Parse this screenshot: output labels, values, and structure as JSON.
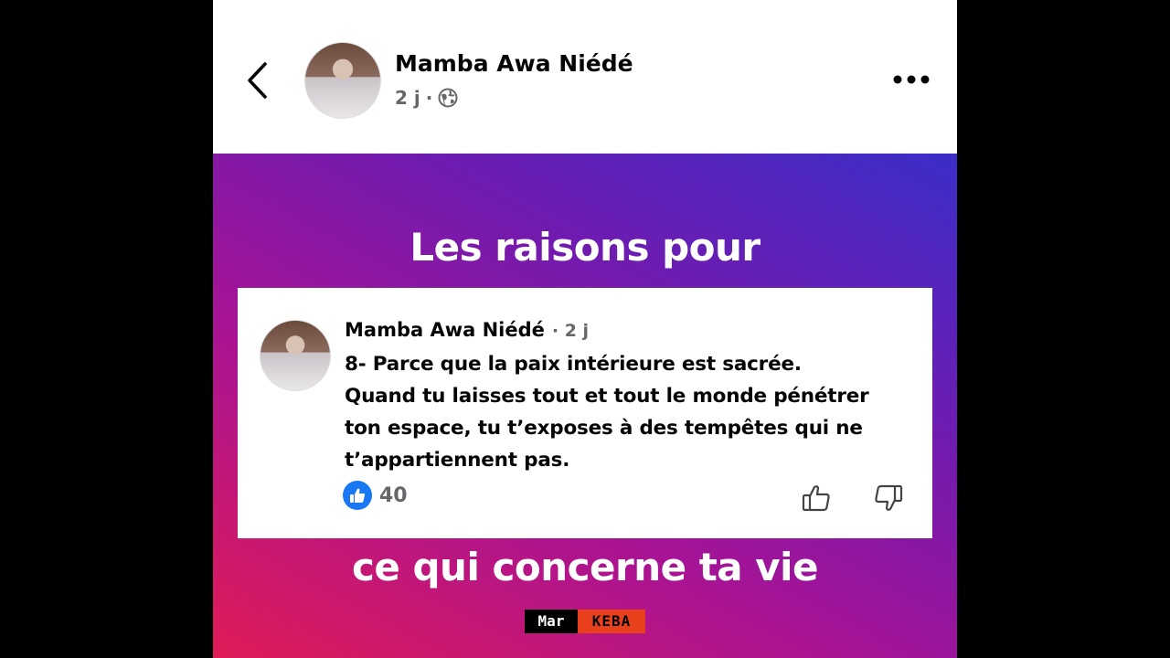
{
  "header": {
    "author_name": "Mamba Awa Niédé",
    "time_ago": "2 j",
    "separator": "·",
    "privacy_icon": "globe-icon",
    "back_icon": "chevron-left-icon",
    "more_icon": "more-horizontal-icon"
  },
  "banner": {
    "top_text": "Les raisons pour",
    "bottom_text": "ce qui concerne ta vie",
    "gradient_colors": [
      "#3b2dc8",
      "#6f1bb0",
      "#a71395",
      "#e01b57"
    ]
  },
  "comment": {
    "author_name": "Mamba Awa Niédé",
    "time_ago": "· 2 j",
    "text_lines": [
      "8- Parce que la paix intérieure est sacrée.",
      "Quand tu laisses tout et tout le monde pénétrer",
      "ton espace, tu t’exposes à des tempêtes qui ne",
      "t’appartiennent pas."
    ],
    "reaction_count": "40",
    "reaction_icon": "like-icon",
    "reaction_color": "#1877f2"
  },
  "watermark": {
    "left": "Mar",
    "right": "KEBA",
    "right_color": "#e8401c"
  }
}
